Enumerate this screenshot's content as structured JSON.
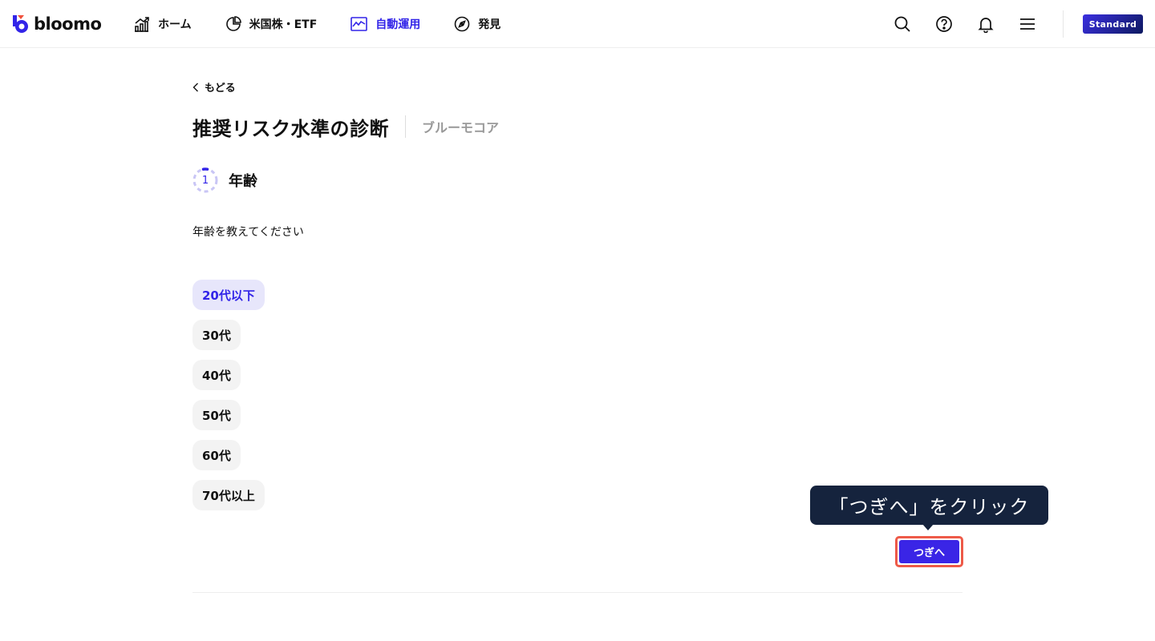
{
  "header": {
    "logo_text": "bloomo",
    "nav": [
      {
        "label": "ホーム",
        "icon": "chart-growth-icon",
        "active": false
      },
      {
        "label": "米国株・ETF",
        "icon": "pie-chart-icon",
        "active": false
      },
      {
        "label": "自動運用",
        "icon": "line-chart-icon",
        "active": true
      },
      {
        "label": "発見",
        "icon": "compass-icon",
        "active": false
      }
    ],
    "plan_badge": "Standard",
    "icons": [
      "search-icon",
      "help-icon",
      "bell-icon",
      "menu-icon"
    ]
  },
  "page": {
    "back_label": "もどる",
    "title": "推奨リスク水準の診断",
    "subtitle": "ブルーモコア",
    "step_number": "1",
    "step_label": "年齢",
    "question": "年齢を教えてください",
    "options": [
      {
        "label": "20代以下",
        "selected": true
      },
      {
        "label": "30代",
        "selected": false
      },
      {
        "label": "40代",
        "selected": false
      },
      {
        "label": "50代",
        "selected": false
      },
      {
        "label": "60代",
        "selected": false
      },
      {
        "label": "70代以上",
        "selected": false
      }
    ],
    "next_label": "つぎへ"
  },
  "tooltip": {
    "text": "「つぎへ」をクリック"
  },
  "colors": {
    "accent": "#3224e8",
    "selected_bg": "#e7e6fb",
    "tooltip_bg": "#15233d",
    "highlight_border": "#ee5a48"
  }
}
